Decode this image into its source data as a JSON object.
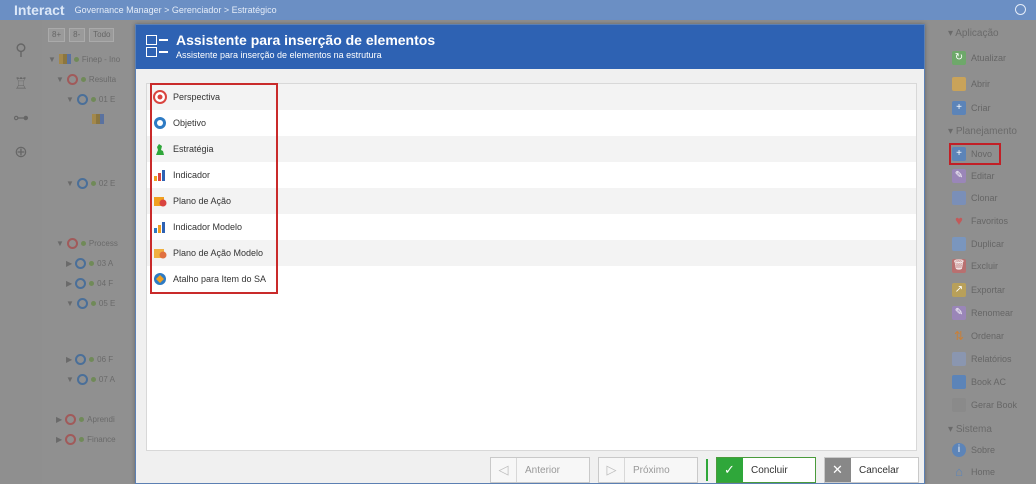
{
  "topbar": {
    "logo": "Interact",
    "breadcrumb": "Governance Manager  >  Gerenciador  >  Estratégico"
  },
  "tree": {
    "toolbar_filter": "Todo",
    "nodes": [
      {
        "label": "Finep - Ino",
        "level": 0
      },
      {
        "label": "Resulta",
        "level": 1
      },
      {
        "label": "01 E",
        "level": 2
      },
      {
        "label": "02 E",
        "level": 2
      },
      {
        "label": "Process",
        "level": 1
      },
      {
        "label": "03 A",
        "level": 2
      },
      {
        "label": "04 F",
        "level": 2
      },
      {
        "label": "05 E",
        "level": 2
      },
      {
        "label": "06 F",
        "level": 2
      },
      {
        "label": "07 A",
        "level": 2
      },
      {
        "label": "Aprendi",
        "level": 1
      },
      {
        "label": "Finance",
        "level": 1
      }
    ]
  },
  "dialog": {
    "title": "Assistente para inserção de elementos",
    "subtitle": "Assistente para inserção de elementos na estrutura",
    "items": [
      {
        "label": "Perspectiva",
        "icon": "perspective-icon"
      },
      {
        "label": "Objetivo",
        "icon": "objective-icon"
      },
      {
        "label": "Estratégia",
        "icon": "strategy-icon"
      },
      {
        "label": "Indicador",
        "icon": "indicator-icon"
      },
      {
        "label": "Plano de Ação",
        "icon": "action-plan-icon"
      },
      {
        "label": "Indicador Modelo",
        "icon": "indicator-model-icon"
      },
      {
        "label": "Plano de Ação Modelo",
        "icon": "action-plan-model-icon"
      },
      {
        "label": "Atalho para Item do SA",
        "icon": "shortcut-icon"
      }
    ],
    "buttons": {
      "previous": "Anterior",
      "next": "Próximo",
      "finish": "Concluir",
      "cancel": "Cancelar"
    }
  },
  "rightpanel": {
    "sections": {
      "application": "Aplicação",
      "planning": "Planejamento",
      "system": "Sistema"
    },
    "application_actions": [
      "Atualizar",
      "Abrir",
      "Criar"
    ],
    "planning_actions": [
      "Novo",
      "Editar",
      "Clonar",
      "Favoritos",
      "Duplicar",
      "Excluir",
      "Exportar",
      "Renomear",
      "Ordenar",
      "Relatórios",
      "Book AC",
      "Gerar Book"
    ],
    "system_actions": [
      "Sobre",
      "Home"
    ]
  },
  "colors": {
    "header_blue": "#2e62b3",
    "highlight_red": "#c92a2a",
    "confirm_green": "#2fa73a"
  }
}
